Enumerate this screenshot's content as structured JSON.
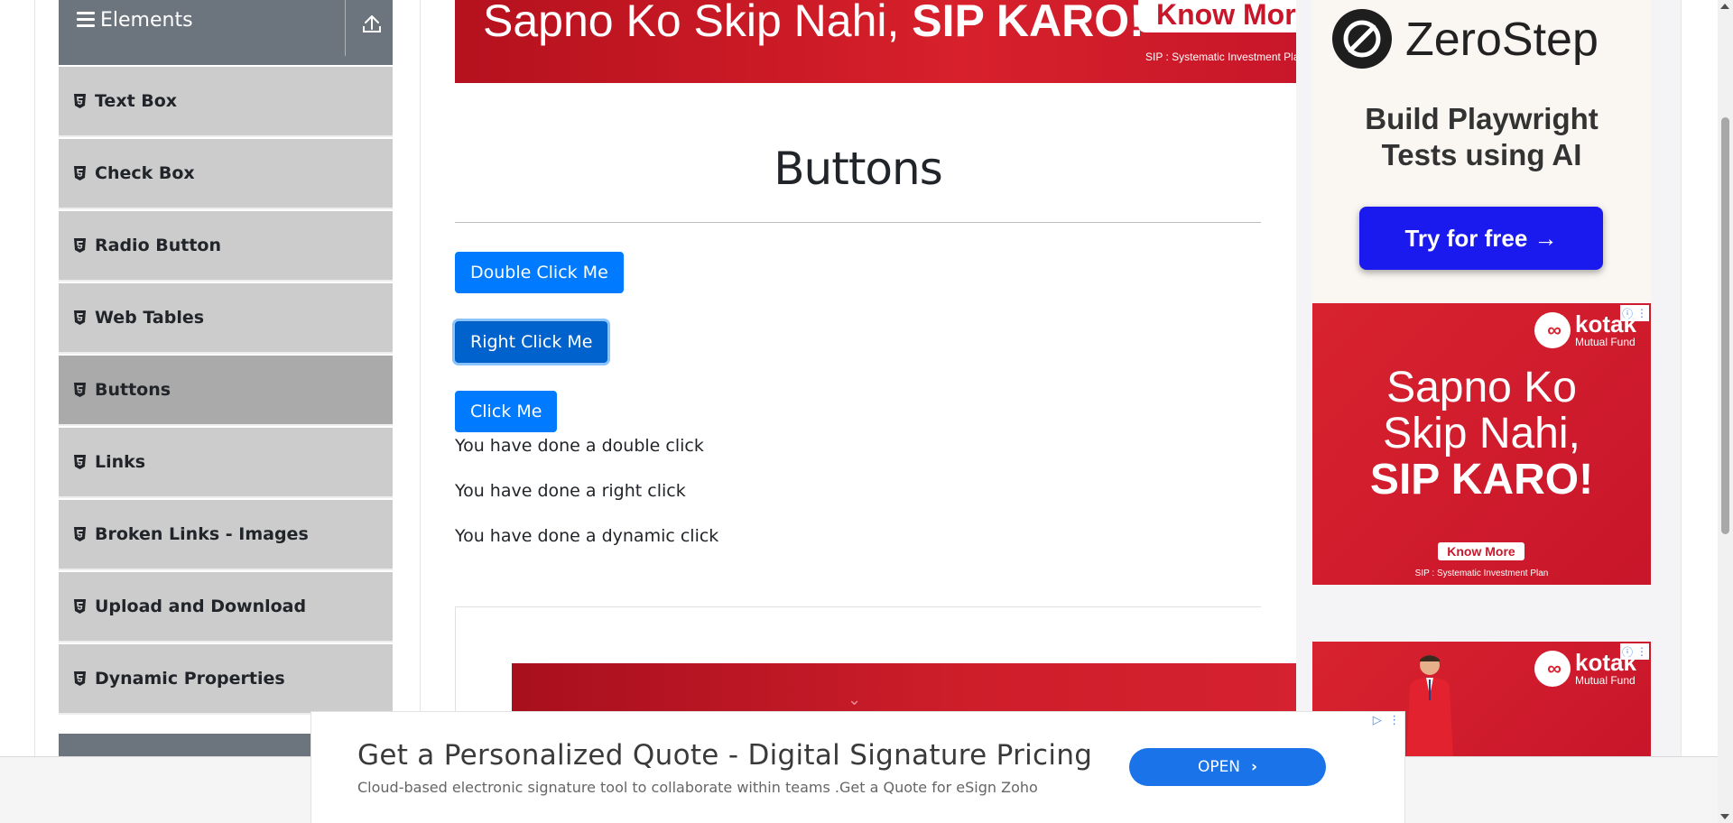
{
  "sidebar": {
    "group_title": "Elements",
    "items": [
      {
        "label": "Text Box"
      },
      {
        "label": "Check Box"
      },
      {
        "label": "Radio Button"
      },
      {
        "label": "Web Tables"
      },
      {
        "label": "Buttons",
        "active": true
      },
      {
        "label": "Links"
      },
      {
        "label": "Broken Links - Images"
      },
      {
        "label": "Upload and Download"
      },
      {
        "label": "Dynamic Properties"
      }
    ]
  },
  "top_ad": {
    "text_regular": "Sapno Ko Skip Nahi, ",
    "text_bold": "SIP KARO!",
    "know_more": "Know More",
    "sip_note": "SIP : Systematic Investment Plan"
  },
  "main": {
    "heading": "Buttons",
    "buttons": {
      "double_click": "Double Click Me",
      "right_click": "Right Click Me",
      "click": "Click Me"
    },
    "messages": {
      "double_click": "You have done a double click",
      "right_click": "You have done a right click",
      "dynamic_click": "You have done a dynamic click"
    }
  },
  "right_ads": {
    "zerostep": {
      "brand": "ZeroStep",
      "tagline_line1": "Build Playwright",
      "tagline_line2": "Tests using AI",
      "cta": "Try for free →"
    },
    "kotak": {
      "brand": "kotak",
      "brand_sub": "Mutual Fund",
      "line1": "Sapno Ko",
      "line2": "Skip Nahi,",
      "line3": "SIP KARO!",
      "know_more": "Know More",
      "sip_note": "SIP : Systematic Investment Plan"
    }
  },
  "bottom_ad": {
    "headline": "Get a Personalized Quote - Digital Signature Pricing",
    "description": "Cloud-based electronic signature tool to collaborate within teams .Get a Quote for eSign Zoho",
    "cta": "OPEN"
  },
  "colors": {
    "primary_button": "#007bff",
    "sidebar_header": "#6c757d",
    "sidebar_item": "#cccccc",
    "sidebar_active": "#aaaaaa",
    "ad_red": "#d7202b"
  }
}
